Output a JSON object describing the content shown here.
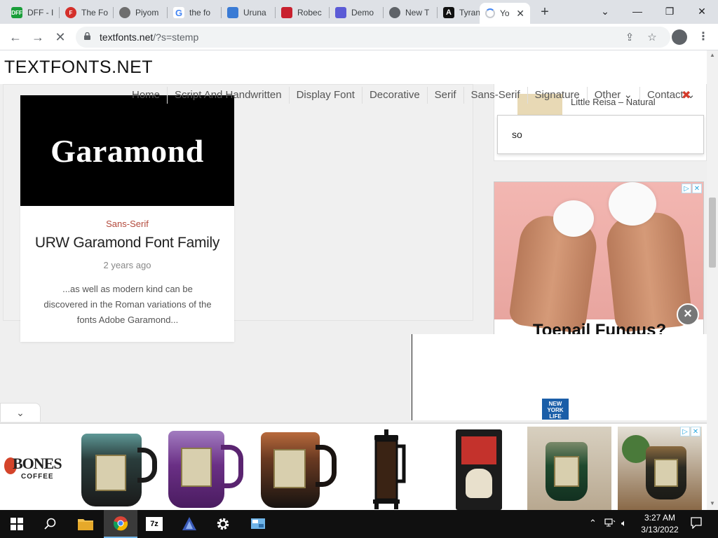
{
  "browser": {
    "tabs": [
      {
        "label": "DFF - I",
        "favicon_text": "DFF",
        "favicon_color": "#1a9e3a"
      },
      {
        "label": "The Fo",
        "favicon_text": "F",
        "favicon_color": "#d4302b"
      },
      {
        "label": "Piyom",
        "favicon_text": "",
        "favicon_color": "#6e6e6e"
      },
      {
        "label": "the fo",
        "favicon_text": "G",
        "favicon_color": "#4285f4"
      },
      {
        "label": "Uruna",
        "favicon_text": "",
        "favicon_color": "#3a7bd5"
      },
      {
        "label": "Robec",
        "favicon_text": "",
        "favicon_color": "#c8202e"
      },
      {
        "label": "Demo",
        "favicon_text": "",
        "favicon_color": "#5b5bd6"
      },
      {
        "label": "New T",
        "favicon_text": "",
        "favicon_color": "#5f6368"
      },
      {
        "label": "Tyrann",
        "favicon_text": "A",
        "favicon_color": "#111111"
      },
      {
        "label": "Yo",
        "favicon_text": "",
        "favicon_color": "",
        "active": true
      }
    ],
    "url_host": "textfonts.net",
    "url_rest": "/?s=stemp"
  },
  "site": {
    "logo": "TEXTFONTS.NET",
    "menu": [
      "Home",
      "Script And Handwritten",
      "Display Font",
      "Decorative",
      "Serif",
      "Sans-Serif",
      "Signature",
      "Other ⌄",
      "Contact ⌄"
    ],
    "menu_close": "✖",
    "popular_text": "Little Reisa – Natural",
    "search_suggestion": "so"
  },
  "card": {
    "image_text": "Garamond",
    "category": "Sans-Serif",
    "title": "URW Garamond Font Family",
    "date": "2 years ago",
    "excerpt": "...as well as modern kind can be discovered in the Roman variations of the fonts Adobe Garamond..."
  },
  "ads": {
    "right_headline": "Toenail Fungus?",
    "close_symbol": "×",
    "nyl_text": "NEW YORK LIFE",
    "bones_brand": "BONES",
    "bones_sub": "COFFEE"
  },
  "taskbar": {
    "time": "3:27 AM",
    "date": "3/13/2022",
    "sevenzip_label": "7z"
  }
}
